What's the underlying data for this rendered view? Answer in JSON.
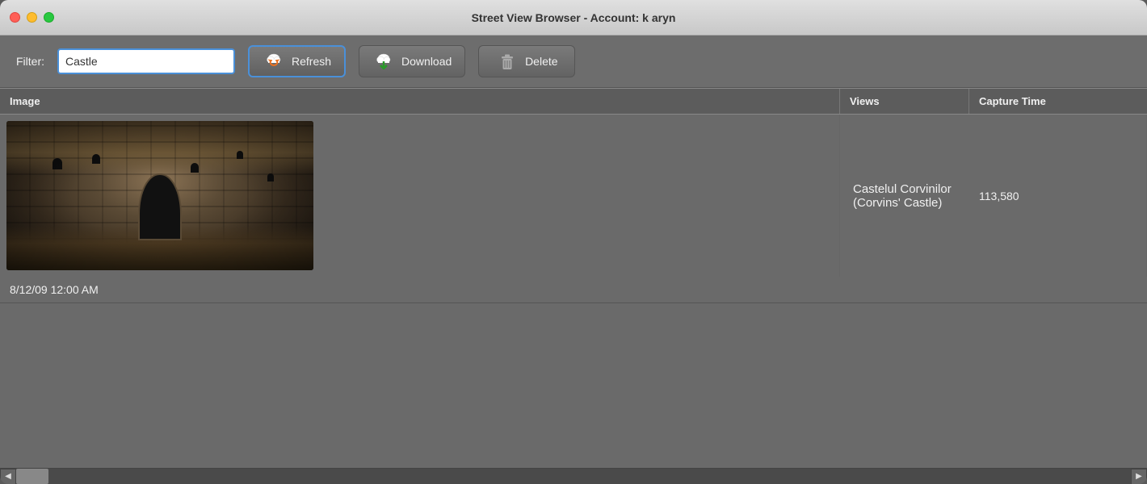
{
  "window": {
    "title": "Street View Browser - Account: k aryn"
  },
  "toolbar": {
    "filter_label": "Filter:",
    "filter_value": "Castle",
    "refresh_label": "Refresh",
    "download_label": "Download",
    "delete_label": "Delete"
  },
  "table": {
    "columns": [
      {
        "key": "image",
        "label": "Image"
      },
      {
        "key": "views",
        "label": "Views"
      },
      {
        "key": "capture_time",
        "label": "Capture Time"
      }
    ],
    "rows": [
      {
        "name": "Castelul Corvinilor (Corvins' Castle)",
        "views": "113,580",
        "capture_time": "8/12/09 12:00 AM"
      }
    ]
  }
}
